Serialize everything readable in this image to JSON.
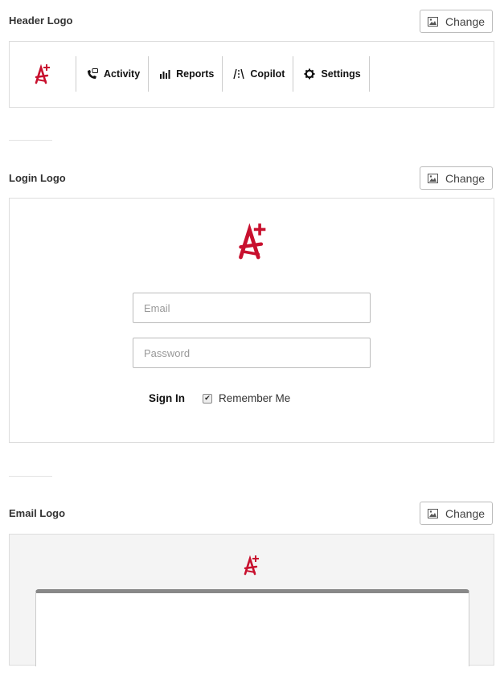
{
  "sections": {
    "header": {
      "title": "Header Logo",
      "change_label": "Change"
    },
    "login": {
      "title": "Login Logo",
      "change_label": "Change"
    },
    "email": {
      "title": "Email Logo",
      "change_label": "Change"
    }
  },
  "header_preview": {
    "logo_icon": "a-plus-logo",
    "nav": [
      {
        "label": "Activity",
        "icon": "phone-chat-icon"
      },
      {
        "label": "Reports",
        "icon": "bar-chart-icon"
      },
      {
        "label": "Copilot",
        "icon": "road-icon"
      },
      {
        "label": "Settings",
        "icon": "gear-icon"
      }
    ]
  },
  "login_preview": {
    "logo_icon": "a-plus-logo",
    "email_placeholder": "Email",
    "password_placeholder": "Password",
    "signin_label": "Sign In",
    "remember_label": "Remember Me",
    "remember_checked": true
  },
  "email_preview": {
    "logo_icon": "a-plus-logo"
  },
  "colors": {
    "brand": "#c8102e",
    "border": "#dddddd",
    "email_bg": "#f4f4f4"
  }
}
